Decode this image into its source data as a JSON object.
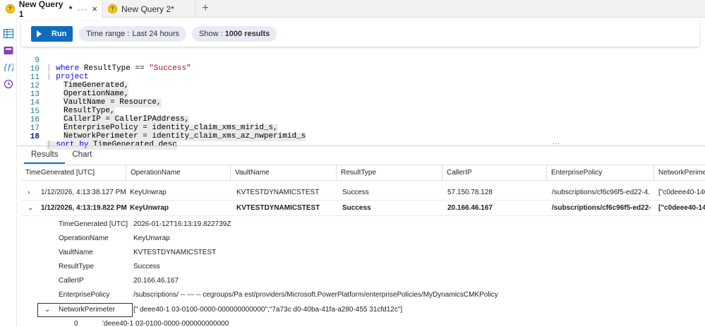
{
  "tabs": [
    {
      "label": "New Query 1",
      "modified": "*",
      "dots": "···",
      "close": "×"
    },
    {
      "label": "New Query 2",
      "modified": "*"
    }
  ],
  "tab_add": "+",
  "toolbar": {
    "run_label": "Run",
    "time_range_label": "Time range :",
    "time_range_value": "Last 24 hours",
    "show_label": "Show :",
    "show_value": "1000 results"
  },
  "code": [
    {
      "n": "9",
      "text": "where ResultType == \"Success\""
    },
    {
      "n": "10",
      "text": "project"
    },
    {
      "n": "11",
      "text": "TimeGenerated,"
    },
    {
      "n": "12",
      "text": "OperationName,"
    },
    {
      "n": "13",
      "text": "VaultName = Resource,"
    },
    {
      "n": "14",
      "text": "ResultType,"
    },
    {
      "n": "15",
      "text": "CallerIP = CallerIPAddress,"
    },
    {
      "n": "16",
      "text": "EnterprisePolicy = identity_claim_xms_mirid_s,"
    },
    {
      "n": "17",
      "text": "NetworkPerimeter = identity_claim_xms_az_nwperimid_s"
    },
    {
      "n": "18",
      "text": "sort by TimeGenerated desc"
    }
  ],
  "code_kw": {
    "where": "where",
    "project": "project",
    "sort": "sort by",
    "pipe": "|",
    "str": "\"Success\"",
    "where_mid": " ResultType == ",
    "sort_rest": " TimeGenerated desc"
  },
  "split_dots": "...",
  "result_tabs": [
    "Results",
    "Chart"
  ],
  "columns": [
    "TimeGenerated [UTC]",
    "OperationName",
    "VaultName",
    "ResultType",
    "CallerIP",
    "EnterprisePolicy",
    "NetworkPerime"
  ],
  "rows": [
    {
      "expand": "›",
      "cells": [
        "1/12/2026, 4:13:38.127 PM",
        "KeyUnwrap",
        "KVTESTDYNAMICSTEST",
        "Success",
        "57.150.78.128",
        "/subscriptions/cf6c96f5-ed22-4...",
        "[\"c0deee40-140"
      ]
    },
    {
      "expand": "⌄",
      "cells": [
        "1/12/2026, 4:13:19.822 PM",
        "KeyUnwrap",
        "KVTESTDYNAMICSTEST",
        "Success",
        "20.166.46.167",
        "/subscriptions/cf6c96f5-ed22-...",
        "[\"c0deee40-140"
      ]
    }
  ],
  "details": [
    {
      "key": "TimeGenerated [UTC]",
      "value": "2026-01-12T16:13:19.822739Z"
    },
    {
      "key": "OperationName",
      "value": "KeyUnwrap"
    },
    {
      "key": "VaultName",
      "value": "KVTESTDYNAMICSTEST"
    },
    {
      "key": "ResultType",
      "value": "Success"
    },
    {
      "key": "CallerIP",
      "value": "20.166.46.167"
    },
    {
      "key": "EnterprisePolicy",
      "value": "/subscriptions/  -- ---           --          cegroups/Pa      est/providers/Microsoft.PowerPlatform/enterprisePolicies/MyDynamicsCMKPolicy"
    }
  ],
  "network_perimeter": {
    "chevron": "⌄",
    "key": "NetworkPerimeter",
    "value": "[\"  deee40-1   03-0100-0000-000000000000\",\"7a73c   d0-40ba-41fa-a280-455   31cfd12c\"]",
    "child_index": "0",
    "child_value": "   'deee40-1   03-0100-0000-000000000000"
  }
}
